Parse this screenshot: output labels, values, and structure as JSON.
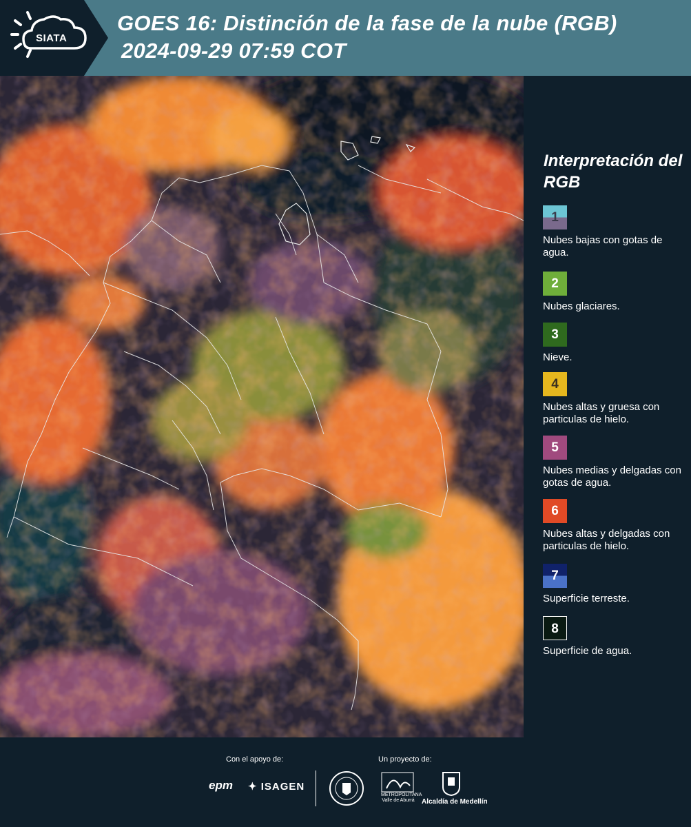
{
  "header": {
    "logo_text": "SIATA",
    "title_line1": "GOES 16: Distinción de la fase de la nube (RGB)",
    "title_line2": "2024-09-29 07:59 COT",
    "background_color": "#4a7a88"
  },
  "legend": {
    "title": "Interpretación del RGB",
    "items": [
      {
        "number": "1",
        "label": "Nubes bajas con gotas de agua.",
        "colors": [
          "#6cc5d4",
          "#7a6a8c"
        ]
      },
      {
        "number": "2",
        "label": "Nubes glaciares.",
        "colors": [
          "#6fae3a"
        ]
      },
      {
        "number": "3",
        "label": "Nieve.",
        "colors": [
          "#2f6a1e"
        ]
      },
      {
        "number": "4",
        "label": "Nubes altas y gruesa con particulas de hielo.",
        "colors": [
          "#e6b71e"
        ]
      },
      {
        "number": "5",
        "label": "Nubes medias y delgadas con gotas de agua.",
        "colors": [
          "#a04a7e"
        ]
      },
      {
        "number": "6",
        "label": "Nubes altas y delgadas con particulas de hielo.",
        "colors": [
          "#e04a26"
        ]
      },
      {
        "number": "7",
        "label": "Superficie terreste.",
        "colors": [
          "#10226a",
          "#4a72c8"
        ]
      },
      {
        "number": "8",
        "label": "Superficie de agua.",
        "colors": [
          "#0a1a12"
        ]
      }
    ]
  },
  "footer": {
    "support_label": "Con el apoyo de:",
    "project_label": "Un proyecto de:",
    "sponsor_1": "epm",
    "sponsor_2": "ISAGEN",
    "partner_area": "METROPOLITANA Valle de Aburrá",
    "partner_medellin": "Alcaldía de Medellín"
  }
}
